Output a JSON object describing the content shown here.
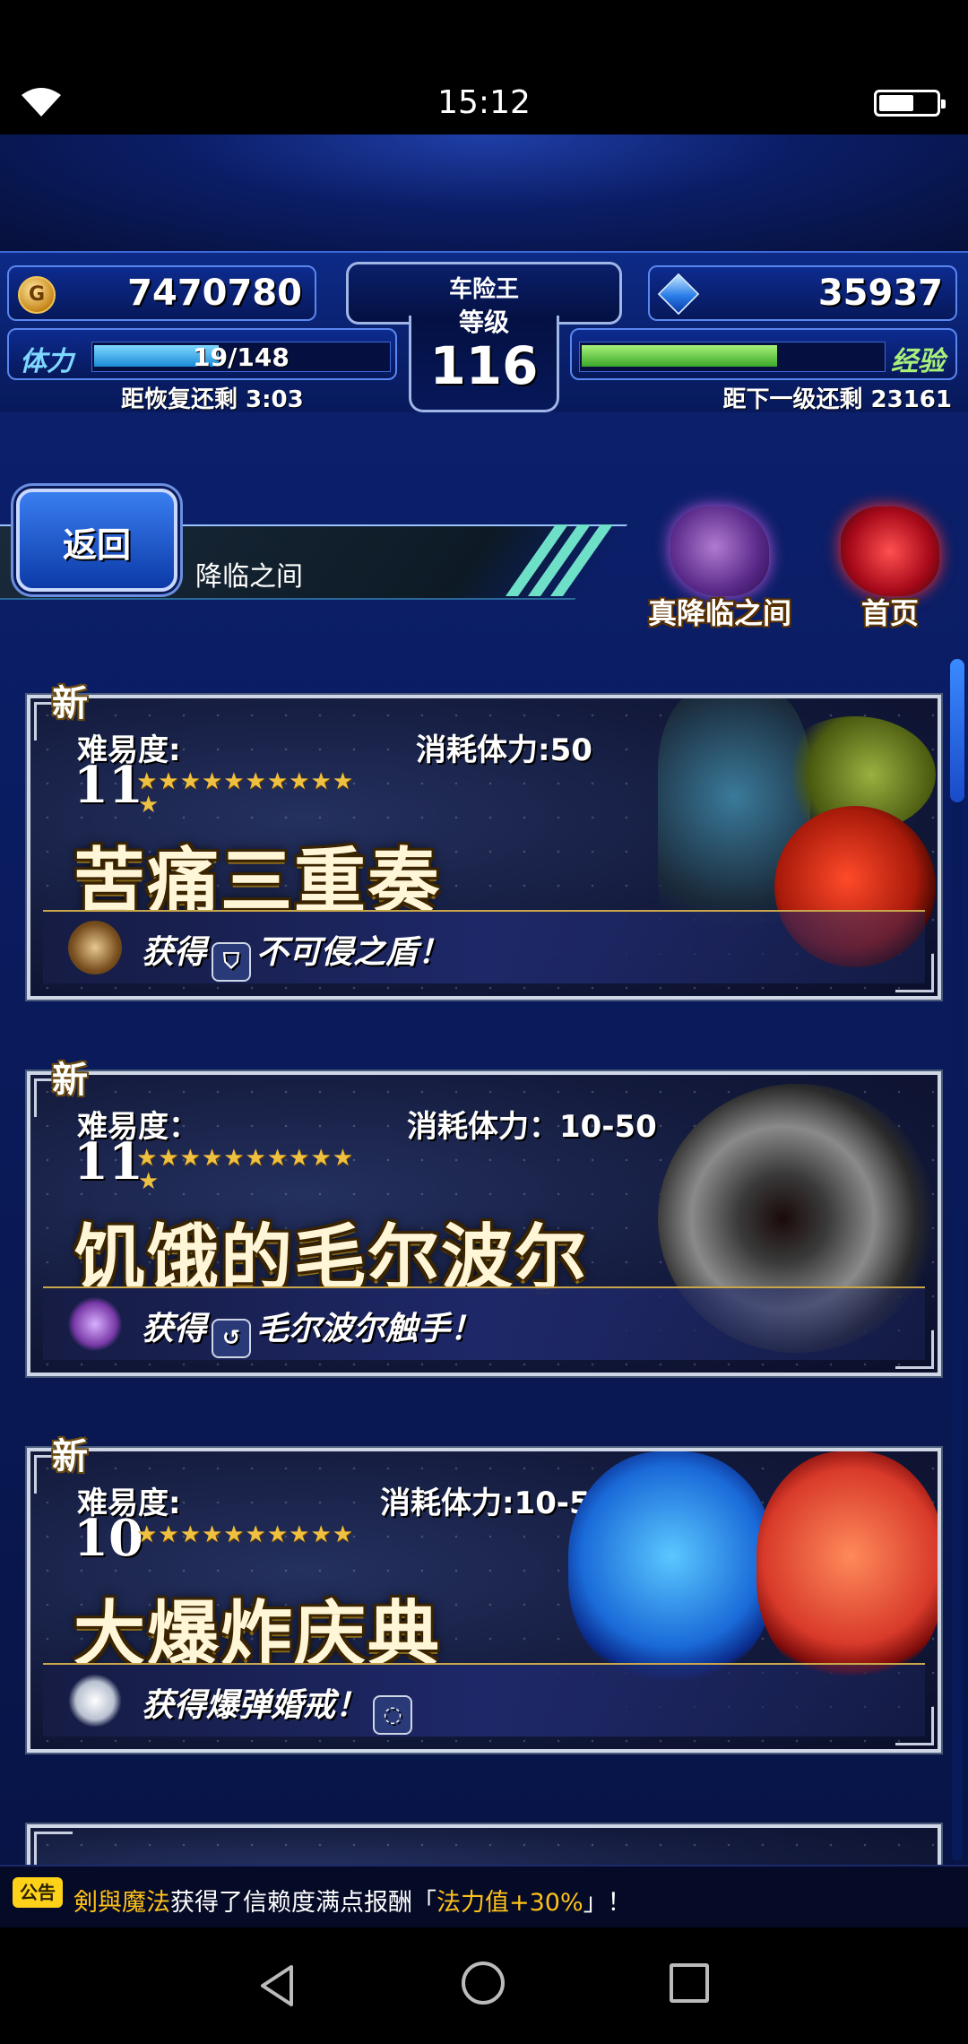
{
  "status_bar": {
    "time": "15:12"
  },
  "header": {
    "gil": "7470780",
    "gems": "35937",
    "player_name": "车险王",
    "level_label": "等级",
    "level": "116",
    "stamina_label": "体力",
    "stamina": "19/148",
    "stamina_fraction": 0.128,
    "stamina_recover_text": "距恢复还剩 3:03",
    "exp_label": "经验",
    "exp_fraction": 0.65,
    "exp_next_text": "距下一级还剩 23161"
  },
  "nav": {
    "back_label": "返回",
    "title": "降临之间",
    "true_vortex_label": "真降临之间",
    "home_label": "首页"
  },
  "events": [
    {
      "new_label": "新",
      "difficulty_label": "难易度:",
      "difficulty": "11",
      "stamina_cost": "消耗体力:50",
      "title": "苦痛三重奏",
      "reward_prefix": "获得",
      "reward_name": "不可侵之盾！"
    },
    {
      "new_label": "新",
      "difficulty_label": "难易度：",
      "difficulty": "11",
      "stamina_cost": "消耗体力：10-50",
      "title": "饥饿的毛尔波尔",
      "reward_prefix": "获得",
      "reward_name": "毛尔波尔触手！"
    },
    {
      "new_label": "新",
      "difficulty_label": "难易度:",
      "difficulty": "10",
      "stamina_cost": "消耗体力:10-50",
      "title": "大爆炸庆典",
      "reward_text": "获得爆弹婚戒！"
    }
  ],
  "ticker": {
    "badge": "公告",
    "name": "剣與魔法",
    "middle": "获得了信赖度满点报酬「",
    "highlight": "法力值+30%",
    "end": "」！"
  },
  "colors": {
    "stamina_fill": "#1a8bd8",
    "exp_fill": "#3aa82a",
    "ticker_highlight": "#ffc21a"
  }
}
